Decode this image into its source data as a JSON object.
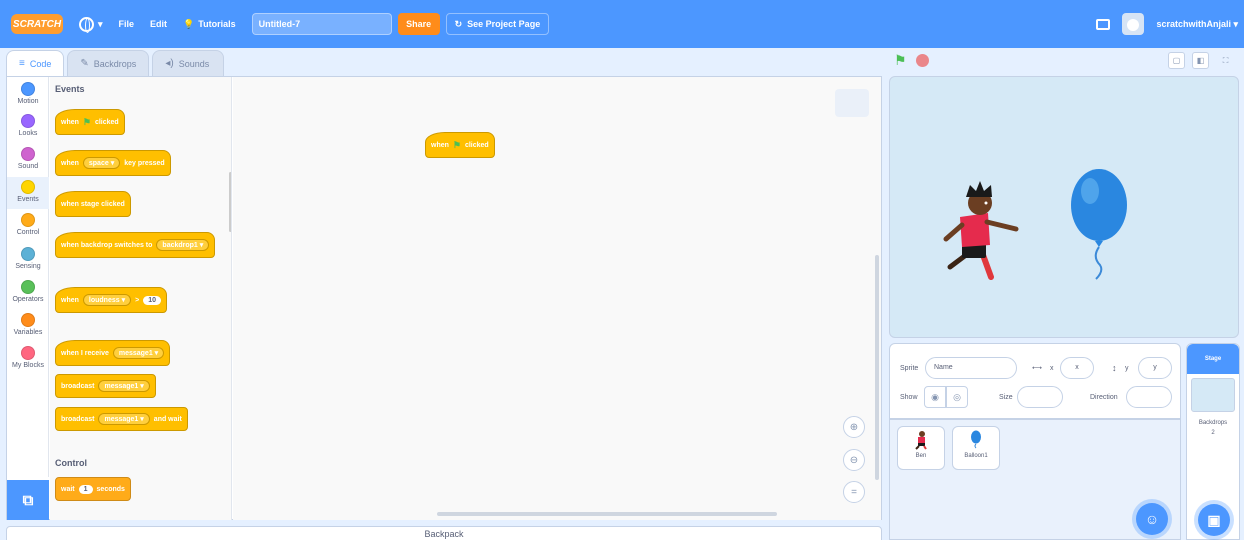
{
  "menubar": {
    "logo": "SCRATCH",
    "file": "File",
    "edit": "Edit",
    "tutorials": "Tutorials",
    "project_title": "Untitled-7",
    "share": "Share",
    "see_project": "See Project Page",
    "username": "scratchwithAnjali"
  },
  "tabs": [
    {
      "label": "Code",
      "icon": "code-icon"
    },
    {
      "label": "Backdrops",
      "icon": "brush-icon"
    },
    {
      "label": "Sounds",
      "icon": "speaker-icon"
    }
  ],
  "categories": [
    {
      "label": "Motion",
      "color": "#4c97ff"
    },
    {
      "label": "Looks",
      "color": "#9966ff"
    },
    {
      "label": "Sound",
      "color": "#cf63cf"
    },
    {
      "label": "Events",
      "color": "#ffd500"
    },
    {
      "label": "Control",
      "color": "#ffab19"
    },
    {
      "label": "Sensing",
      "color": "#5cb1d6"
    },
    {
      "label": "Operators",
      "color": "#59c059"
    },
    {
      "label": "Variables",
      "color": "#ff8c1a"
    },
    {
      "label": "My Blocks",
      "color": "#ff6680"
    }
  ],
  "palette": {
    "events_heading": "Events",
    "control_heading": "Control",
    "blocks": {
      "when_flag_1": "when",
      "when_flag_2": "clicked",
      "when_key_1": "when",
      "when_key_drop": "space",
      "when_key_2": "key pressed",
      "stage_clicked": "when stage clicked",
      "backdrop_switch": "when backdrop switches to",
      "backdrop_drop": "backdrop1",
      "loudness_when": "when",
      "loudness_drop": "loudness",
      "loudness_op": ">",
      "loudness_val": "10",
      "receive": "when I receive",
      "receive_drop": "message1",
      "broadcast": "broadcast",
      "broadcast_drop": "message1",
      "broadcast_wait": "broadcast",
      "broadcast_wait_drop": "message1",
      "and_wait": "and wait",
      "wait": "wait",
      "wait_val": "1",
      "seconds": "seconds"
    }
  },
  "script": {
    "when": "when",
    "clicked": "clicked"
  },
  "backpack": "Backpack",
  "sprite_info": {
    "sprite_label": "Sprite",
    "sprite_name_placeholder": "Name",
    "x_label": "x",
    "x_placeholder": "x",
    "y_label": "y",
    "y_placeholder": "y",
    "show_label": "Show",
    "size_label": "Size",
    "direction_label": "Direction"
  },
  "sprites": [
    {
      "name": "Ben"
    },
    {
      "name": "Balloon1"
    }
  ],
  "stage_panel": {
    "title": "Stage",
    "backdrops_label": "Backdrops",
    "backdrops_count": "2"
  }
}
